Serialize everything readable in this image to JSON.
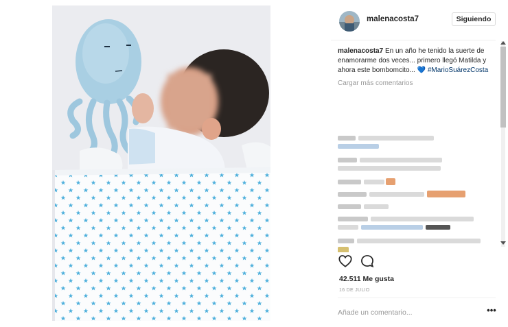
{
  "post": {
    "username": "malenacosta7",
    "follow_label": "Siguiendo",
    "caption": {
      "username": "malenacosta7",
      "text": "En un año he tenido la suerte de enamorarme dos veces... primero llegó Matilda y ahora este bombomcito... ",
      "heart": "💙",
      "hashtag": "#MarioSuárezCosta"
    },
    "load_more_label": "Cargar más comentarios",
    "likes": "42.511 Me gusta",
    "date": "16 DE JULIO",
    "comment_placeholder": "Añade un comentario...",
    "more_options": "•••"
  },
  "icons": {
    "like": "heart-outline-icon",
    "comment": "comment-bubble-icon",
    "more": "more-options-icon"
  },
  "colors": {
    "link": "#003569",
    "accent": "#3897f0",
    "muted": "#999999",
    "text": "#262626",
    "border": "#dbdbdb"
  }
}
